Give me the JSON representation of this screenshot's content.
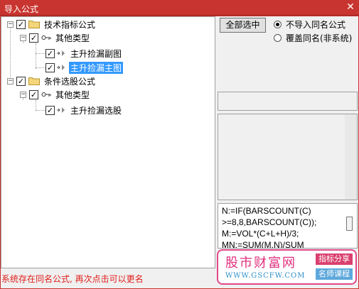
{
  "window": {
    "title": "导入公式",
    "close_glyph": "✕"
  },
  "tree": {
    "groups": [
      {
        "label": "技术指标公式",
        "expander": "−",
        "checked": true,
        "sub": {
          "label": "其他类型",
          "expander": "−",
          "checked": true,
          "items": [
            {
              "label": "主升捡漏副图",
              "checked": true,
              "selected": false
            },
            {
              "label": "主升捡漏主图",
              "checked": true,
              "selected": true
            }
          ]
        }
      },
      {
        "label": "条件选股公式",
        "expander": "−",
        "checked": true,
        "sub": {
          "label": "其他类型",
          "expander": "−",
          "checked": true,
          "items": [
            {
              "label": "主升捡漏选股",
              "checked": true,
              "selected": false
            }
          ]
        }
      }
    ],
    "check_glyph": "✓"
  },
  "select_all_button": "全部选中",
  "options": [
    {
      "label": "不导入同名公式",
      "selected": true
    },
    {
      "label": "覆盖同名(非系统)",
      "selected": false
    }
  ],
  "code_lines": [
    "N:=IF(BARSCOUNT(C)",
    ">=8,8,BARSCOUNT(C));",
    "M:=VOL*(C+L+H)/3;",
    "MN:=SUM(M,N)/SUM"
  ],
  "status_message": "系统存在同名公式, 再次点击可以更名",
  "watermark": {
    "brand": "股市财富网",
    "url": "WWW.GSCFW.COM",
    "tag1": "指标分享",
    "tag2": "名师课程",
    "accent_color": "#e0307f",
    "url_color": "#2d8fc8"
  },
  "colors": {
    "titlebar": "#c8342f",
    "selection": "#3399ff",
    "status_text": "#e0201c"
  }
}
